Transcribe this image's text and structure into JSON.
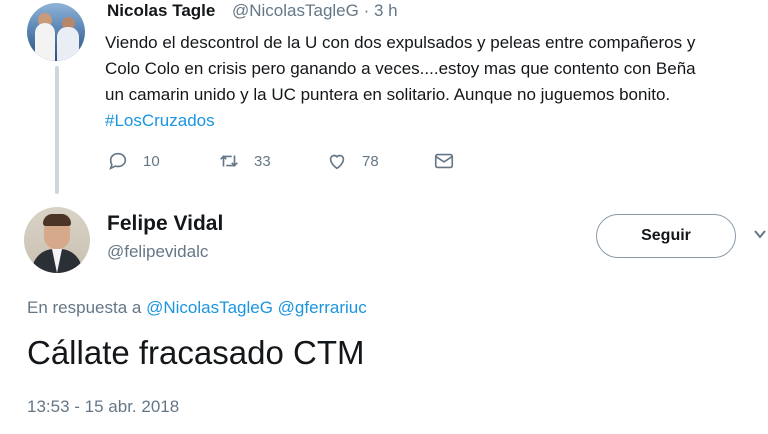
{
  "tweet1": {
    "display_name": "Nicolas Tagle",
    "handle_time": "@NicolasTagleG · 3 h",
    "lines": [
      "Viendo el descontrol de la U con dos expulsados y peleas entre compañeros y",
      "Colo Colo en crisis pero ganando a veces....estoy mas que contento con Beña",
      "un camarin unido y la UC puntera en solitario. Aunque no juguemos bonito."
    ],
    "hashtag": "#LosCruzados",
    "actions": {
      "reply_count": "10",
      "retweet_count": "33",
      "like_count": "78"
    },
    "icons": {
      "reply": "reply-icon",
      "retweet": "retweet-icon",
      "like": "heart-icon",
      "message": "envelope-icon"
    }
  },
  "tweet2": {
    "display_name": "Felipe Vidal",
    "handle": "@felipevidalc",
    "follow_label": "Seguir",
    "reply_prefix": "En respuesta a",
    "reply_mentions": "@NicolasTagleG @gferrariuc",
    "text": "Cállate fracasado CTM",
    "timestamp": "13:53 - 15 abr. 2018"
  },
  "colors": {
    "text": "#14171a",
    "secondary": "#657786",
    "link": "#1b95e0",
    "thread_line": "#ccd6dd"
  }
}
